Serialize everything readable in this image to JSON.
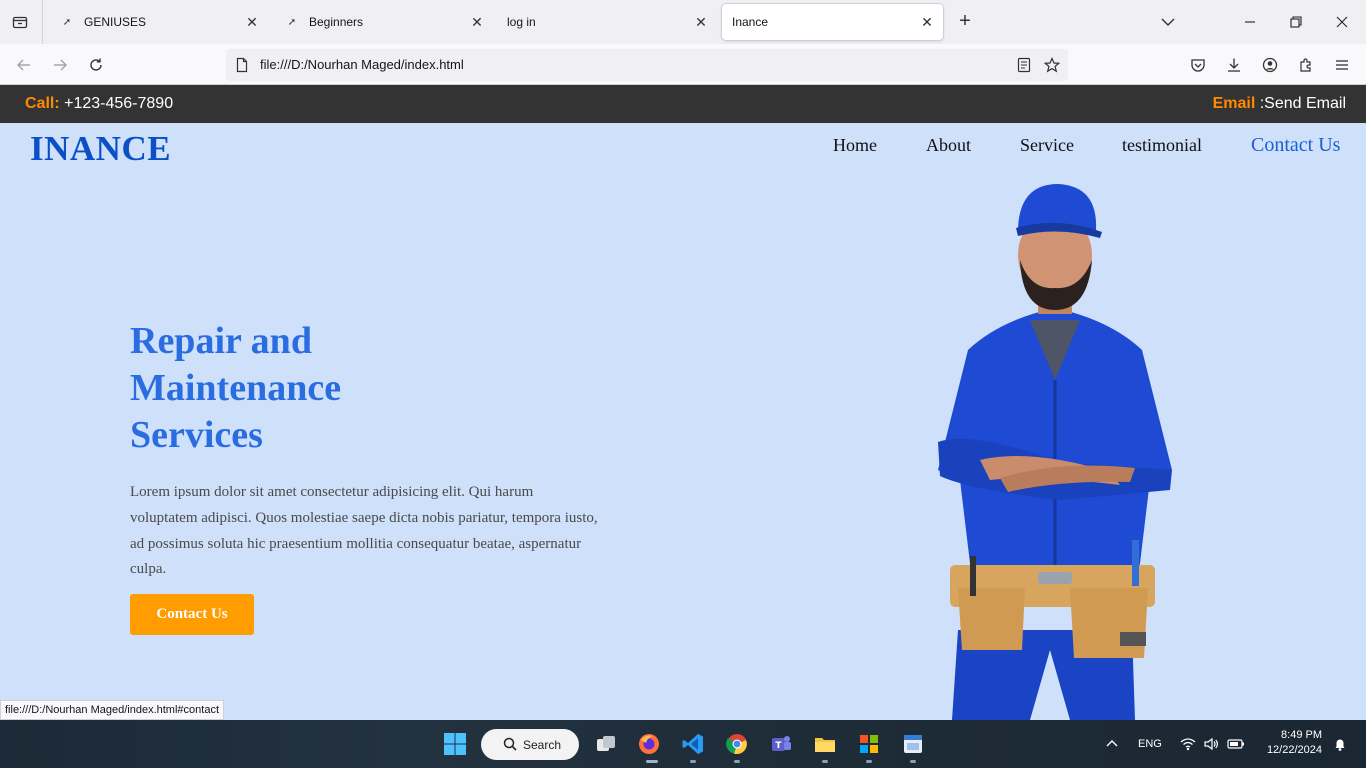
{
  "browser": {
    "tabs": [
      {
        "title": "GENIUSES",
        "active": false
      },
      {
        "title": "Beginners",
        "active": false
      },
      {
        "title": "log in",
        "active": false
      },
      {
        "title": "Inance",
        "active": true
      }
    ],
    "url": "file:///D:/Nourhan Maged/index.html",
    "status_url": "file:///D:/Nourhan Maged/index.html#contact"
  },
  "site": {
    "topbar": {
      "call_label": "Call:",
      "phone": " +123-456-7890",
      "email_label": "Email",
      "email_text": " :Send Email"
    },
    "logo": "INANCE",
    "nav": {
      "home": "Home",
      "about": "About",
      "service": "Service",
      "testimonial": "testimonial",
      "contact": "Contact Us"
    },
    "hero": {
      "title_line1": "Repair and",
      "title_line2": "Maintenance",
      "title_line3": "Services",
      "description": "Lorem ipsum dolor sit amet consectetur adipisicing elit. Qui harum voluptatem adipisci. Quos molestiae saepe dicta nobis pariatur, tempora iusto, ad possimus soluta hic praesentium mollitia consequatur beatae, aspernatur culpa.",
      "button": "Contact Us"
    },
    "colors": {
      "accent_orange": "#ff8a00",
      "button_orange": "#ff9d00",
      "logo_blue": "#0b50c7",
      "page_bg": "#cfe0fb",
      "topbar_bg": "#333333"
    }
  },
  "taskbar": {
    "search_label": "Search",
    "language": "ENG",
    "time": "8:49 PM",
    "date": "12/22/2024"
  }
}
